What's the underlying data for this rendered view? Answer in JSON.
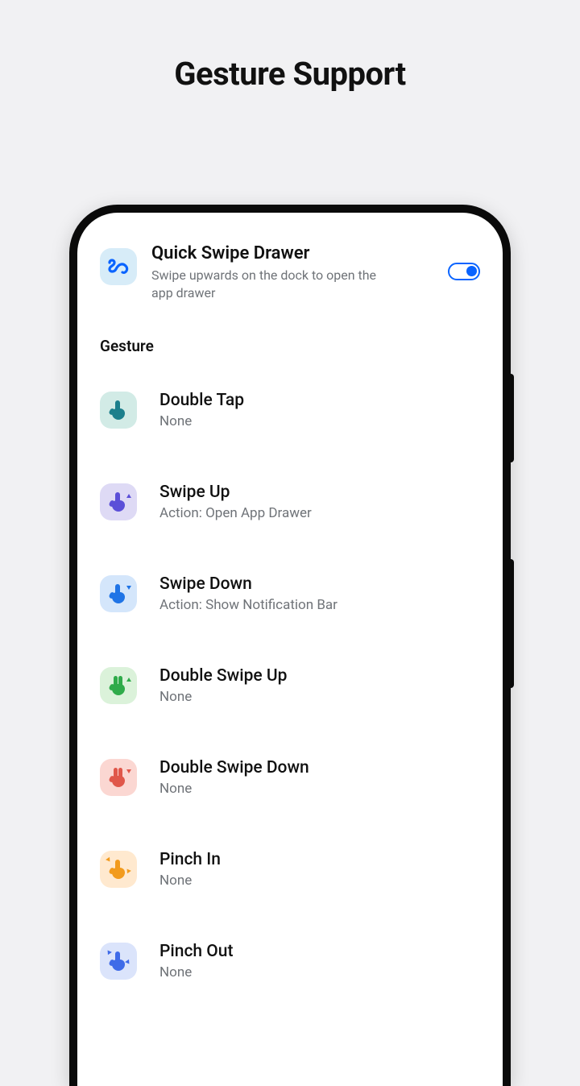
{
  "page_title": "Gesture Support",
  "quick_swipe": {
    "title": "Quick Swipe Drawer",
    "subtitle": "Swipe upwards on the dock to open the app drawer",
    "enabled": true
  },
  "section_label": "Gesture",
  "gestures": [
    {
      "title": "Double Tap",
      "subtitle": "None",
      "icon": "double-tap-icon"
    },
    {
      "title": "Swipe Up",
      "subtitle": "Action: Open App Drawer",
      "icon": "swipe-up-icon"
    },
    {
      "title": "Swipe Down",
      "subtitle": "Action: Show Notification Bar",
      "icon": "swipe-down-icon"
    },
    {
      "title": "Double Swipe Up",
      "subtitle": "None",
      "icon": "double-swipe-up-icon"
    },
    {
      "title": "Double Swipe Down",
      "subtitle": "None",
      "icon": "double-swipe-down-icon"
    },
    {
      "title": "Pinch In",
      "subtitle": "None",
      "icon": "pinch-in-icon"
    },
    {
      "title": "Pinch Out",
      "subtitle": "None",
      "icon": "pinch-out-icon"
    }
  ]
}
